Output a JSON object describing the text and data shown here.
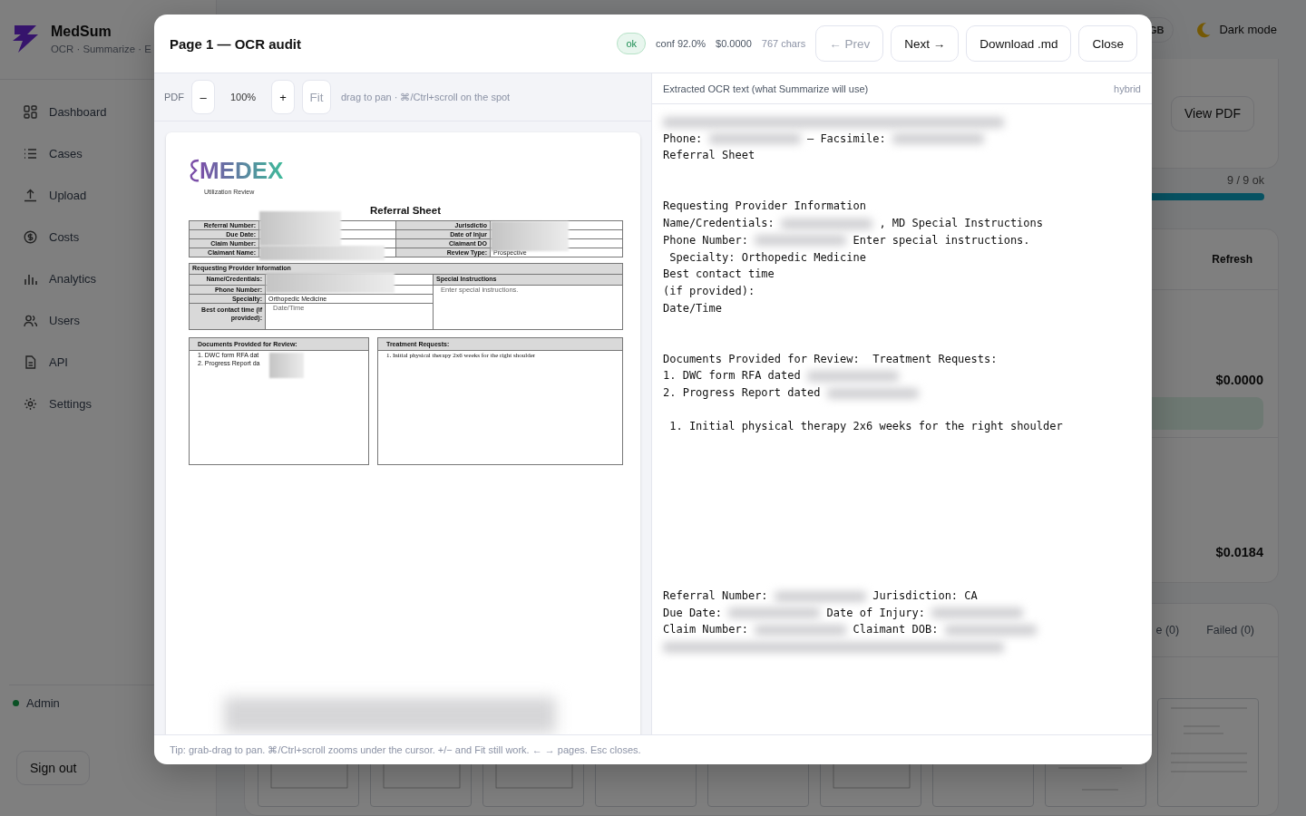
{
  "sidebar": {
    "brand": "MedSum",
    "tagline": "OCR · Summarize · E",
    "nav": [
      {
        "kind": "dashboard",
        "label": "Dashboard"
      },
      {
        "kind": "cases",
        "label": "Cases"
      },
      {
        "kind": "upload",
        "label": "Upload"
      },
      {
        "kind": "costs",
        "label": "Costs"
      },
      {
        "kind": "analytics",
        "label": "Analytics"
      },
      {
        "kind": "users",
        "label": "Users"
      },
      {
        "kind": "api",
        "label": "API"
      },
      {
        "kind": "settings",
        "label": "Settings"
      }
    ],
    "user": {
      "name": "Admin",
      "online": true
    },
    "sign_out": "Sign out"
  },
  "topbar": {
    "language": "GB",
    "theme_toggle": "Dark mode"
  },
  "main": {
    "view_pdf": "View PDF",
    "progress": {
      "text": "9 / 9 ok",
      "level": 1
    },
    "refresh": "Refresh",
    "costs": [
      "$0.0000",
      "$0.0184"
    ],
    "tabs": [
      {
        "label": "e (0)",
        "selected": false
      },
      {
        "label": "Failed (0)",
        "selected": false
      }
    ],
    "page_thumbnails": [
      {
        "kind": "form"
      },
      {
        "kind": "form"
      },
      {
        "kind": "form"
      },
      {
        "kind": "letter"
      },
      {
        "kind": "letter"
      },
      {
        "kind": "form"
      },
      {
        "kind": "letter"
      },
      {
        "kind": "signature"
      },
      {
        "kind": "letterhead"
      }
    ]
  },
  "modal": {
    "title": "Page 1 — OCR audit",
    "status": "ok",
    "confidence": "conf 92.0%",
    "cost": "$0.0000",
    "chars": "767 chars",
    "buttons": [
      {
        "label": "← Prev",
        "disabled": true
      },
      {
        "label": "Next →",
        "disabled": false
      },
      {
        "label": "Download .md",
        "disabled": false
      },
      {
        "label": "Close",
        "disabled": false
      }
    ],
    "viewer": {
      "label": "PDF",
      "zoom_out": "–",
      "zoom": "100%",
      "zoom_in": "+",
      "fit": {
        "label": "Fit",
        "disabled": true
      },
      "hint": "drag to pan · ⌘/Ctrl+scroll on the spot"
    },
    "document": {
      "logo": "MEDEX",
      "logo_subtitle": "Utilization Review",
      "heading": "Referral Sheet",
      "claim_left": [
        "Referral Number:",
        "Due Date:",
        "Claim Number:",
        "Claimant Name:"
      ],
      "claim_right": [
        {
          "label": "Jurisdictio"
        },
        {
          "label": "Date of Injur"
        },
        {
          "label": "Claimant DO"
        },
        {
          "label": "Review Type:",
          "value": "Prospective"
        }
      ],
      "provider": {
        "heading": "Requesting Provider Information",
        "fields": [
          {
            "label": "Name/Credentials:"
          },
          {
            "label": "Phone Number:"
          },
          {
            "label": "Specialty:",
            "value": "Orthopedic Medicine"
          },
          {
            "label": "Best contact time (if provided):",
            "placeholder": "Date/Time"
          }
        ],
        "special_heading": "Special Instructions",
        "special_placeholder": "Enter special instructions."
      },
      "documents": {
        "heading": "Documents Provided for Review:",
        "items": [
          "1. DWC form RFA dat",
          "2. Progress Report da"
        ]
      },
      "treatment": {
        "heading": "Treatment Requests:",
        "items": [
          "1. Initial physical therapy 2x6 weeks for the right shoulder"
        ]
      }
    },
    "ocr_panel": {
      "title": "Extracted OCR text (what Summarize will use)",
      "mode": "hybrid",
      "blocks": [
        [
          [
            {
              "kind": "redacted_long"
            }
          ],
          [
            {
              "kind": "text",
              "text": "Phone:"
            },
            {
              "kind": "redacted"
            },
            {
              "kind": "text",
              "text": "— Facsimile:"
            },
            {
              "kind": "redacted"
            }
          ],
          [
            {
              "kind": "text",
              "text": "Referral Sheet"
            }
          ]
        ],
        [
          [
            {
              "kind": "text",
              "text": "Requesting Provider Information"
            }
          ],
          [
            {
              "kind": "text",
              "text": "Name/Credentials:"
            },
            {
              "kind": "redacted"
            },
            {
              "kind": "text",
              "text": ", MD Special Instructions"
            }
          ],
          [
            {
              "kind": "text",
              "text": "Phone Number:"
            },
            {
              "kind": "redacted"
            },
            {
              "kind": "text",
              "text": "Enter special instructions."
            }
          ],
          [
            {
              "kind": "text",
              "text": " Specialty: Orthopedic Medicine"
            }
          ],
          [
            {
              "kind": "text",
              "text": "Best contact time"
            }
          ],
          [
            {
              "kind": "text",
              "text": "(if provided):"
            }
          ],
          [
            {
              "kind": "text",
              "text": "Date/Time"
            }
          ]
        ],
        [
          [
            {
              "kind": "text",
              "text": "Documents Provided for Review:  Treatment Requests:"
            }
          ],
          [
            {
              "kind": "text",
              "text": "1. DWC form RFA dated"
            },
            {
              "kind": "redacted"
            }
          ],
          [
            {
              "kind": "text",
              "text": "2. Progress Report dated"
            },
            {
              "kind": "redacted"
            }
          ]
        ],
        [
          [
            {
              "kind": "text",
              "text": " 1. Initial physical therapy 2x6 weeks for the right shoulder"
            }
          ]
        ],
        [
          [
            {
              "kind": "text",
              "text": "Referral Number:"
            },
            {
              "kind": "redacted"
            },
            {
              "kind": "text",
              "text": "Jurisdiction: CA"
            }
          ],
          [
            {
              "kind": "text",
              "text": "Due Date:"
            },
            {
              "kind": "redacted"
            },
            {
              "kind": "text",
              "text": "Date of Injury:"
            },
            {
              "kind": "redacted"
            }
          ],
          [
            {
              "kind": "text",
              "text": "Claim Number:"
            },
            {
              "kind": "redacted"
            },
            {
              "kind": "text",
              "text": "Claimant DOB:"
            },
            {
              "kind": "redacted"
            }
          ],
          [
            {
              "kind": "redacted_long"
            }
          ]
        ]
      ]
    },
    "tip": "Tip: grab-drag to pan. ⌘/Ctrl+scroll zooms under the cursor. +/− and Fit still work. ← → pages. Esc closes."
  }
}
